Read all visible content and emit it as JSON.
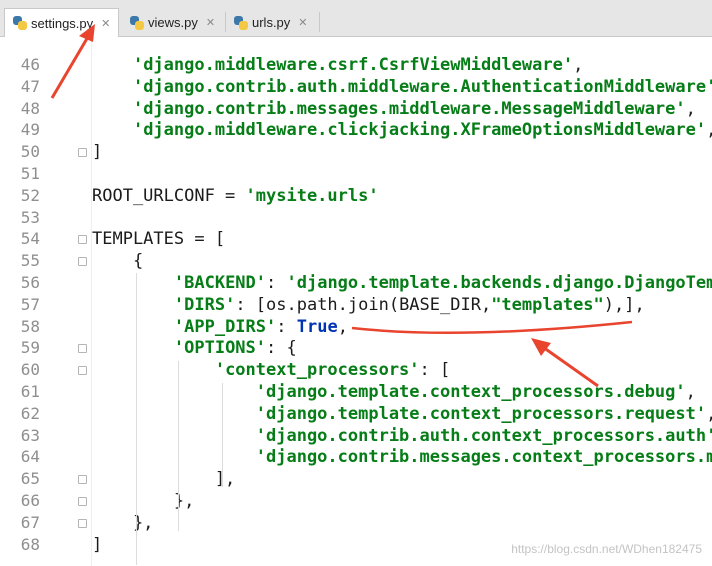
{
  "tabs": [
    {
      "label": "settings.py",
      "active": true,
      "icon": "python-file-icon"
    },
    {
      "label": "views.py",
      "active": false,
      "icon": "python-file-icon"
    },
    {
      "label": "urls.py",
      "active": false,
      "icon": "python-file-icon"
    }
  ],
  "editor": {
    "lines": [
      {
        "n": "46",
        "text": "    'django.middleware.csrf.CsrfViewMiddleware',"
      },
      {
        "n": "47",
        "text": "    'django.contrib.auth.middleware.AuthenticationMiddleware',"
      },
      {
        "n": "48",
        "text": "    'django.contrib.messages.middleware.MessageMiddleware',"
      },
      {
        "n": "49",
        "text": "    'django.middleware.clickjacking.XFrameOptionsMiddleware',"
      },
      {
        "n": "50",
        "text": "]"
      },
      {
        "n": "51",
        "text": ""
      },
      {
        "n": "52",
        "text": "ROOT_URLCONF = 'mysite.urls'"
      },
      {
        "n": "53",
        "text": ""
      },
      {
        "n": "54",
        "text": "TEMPLATES = ["
      },
      {
        "n": "55",
        "text": "    {"
      },
      {
        "n": "56",
        "text": "        'BACKEND': 'django.template.backends.django.DjangoTemplates',"
      },
      {
        "n": "57",
        "text": "        'DIRS': [os.path.join(BASE_DIR,\"templates\"),],"
      },
      {
        "n": "58",
        "text": "        'APP_DIRS': True,"
      },
      {
        "n": "59",
        "text": "        'OPTIONS': {"
      },
      {
        "n": "60",
        "text": "            'context_processors': ["
      },
      {
        "n": "61",
        "text": "                'django.template.context_processors.debug',"
      },
      {
        "n": "62",
        "text": "                'django.template.context_processors.request',"
      },
      {
        "n": "63",
        "text": "                'django.contrib.auth.context_processors.auth',"
      },
      {
        "n": "64",
        "text": "                'django.contrib.messages.context_processors.messages',"
      },
      {
        "n": "65",
        "text": "            ],"
      },
      {
        "n": "66",
        "text": "        },"
      },
      {
        "n": "67",
        "text": "    },"
      },
      {
        "n": "68",
        "text": "]"
      }
    ]
  },
  "colors": {
    "annotation": "#e8442e",
    "string": "#067d17",
    "keyword": "#0033b3"
  },
  "watermark": "https://blog.csdn.net/WDhen182475"
}
